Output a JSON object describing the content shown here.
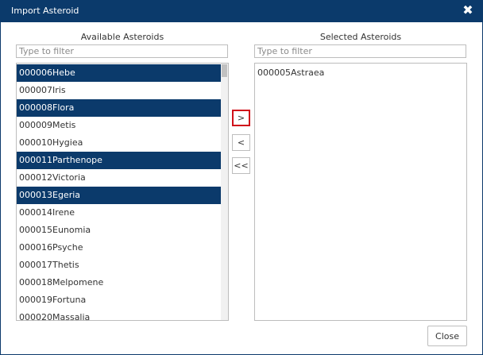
{
  "dialog": {
    "title": "Import Asteroid",
    "close_glyph": "✖"
  },
  "available": {
    "header": "Available Asteroids",
    "filter_placeholder": "Type to filter",
    "items": [
      {
        "num": "000006",
        "name": "Hebe",
        "selected": true
      },
      {
        "num": "000007",
        "name": "Iris",
        "selected": false
      },
      {
        "num": "000008",
        "name": "Flora",
        "selected": true
      },
      {
        "num": "000009",
        "name": "Metis",
        "selected": false
      },
      {
        "num": "000010",
        "name": "Hygiea",
        "selected": false
      },
      {
        "num": "000011",
        "name": "Parthenope",
        "selected": true
      },
      {
        "num": "000012",
        "name": "Victoria",
        "selected": false
      },
      {
        "num": "000013",
        "name": "Egeria",
        "selected": true
      },
      {
        "num": "000014",
        "name": "Irene",
        "selected": false
      },
      {
        "num": "000015",
        "name": "Eunomia",
        "selected": false
      },
      {
        "num": "000016",
        "name": "Psyche",
        "selected": false
      },
      {
        "num": "000017",
        "name": "Thetis",
        "selected": false
      },
      {
        "num": "000018",
        "name": "Melpomene",
        "selected": false
      },
      {
        "num": "000019",
        "name": "Fortuna",
        "selected": false
      },
      {
        "num": "000020",
        "name": "Massalia",
        "selected": false
      }
    ]
  },
  "selected": {
    "header": "Selected Asteroids",
    "filter_placeholder": "Type to filter",
    "items": [
      {
        "num": "000005",
        "name": "Astraea"
      }
    ]
  },
  "controls": {
    "move_selected": ">",
    "remove_selected": "<",
    "remove_all": "<<",
    "close_label": "Close"
  },
  "colors": {
    "accent": "#0b3a6b",
    "focus_outline": "#d0101a"
  }
}
